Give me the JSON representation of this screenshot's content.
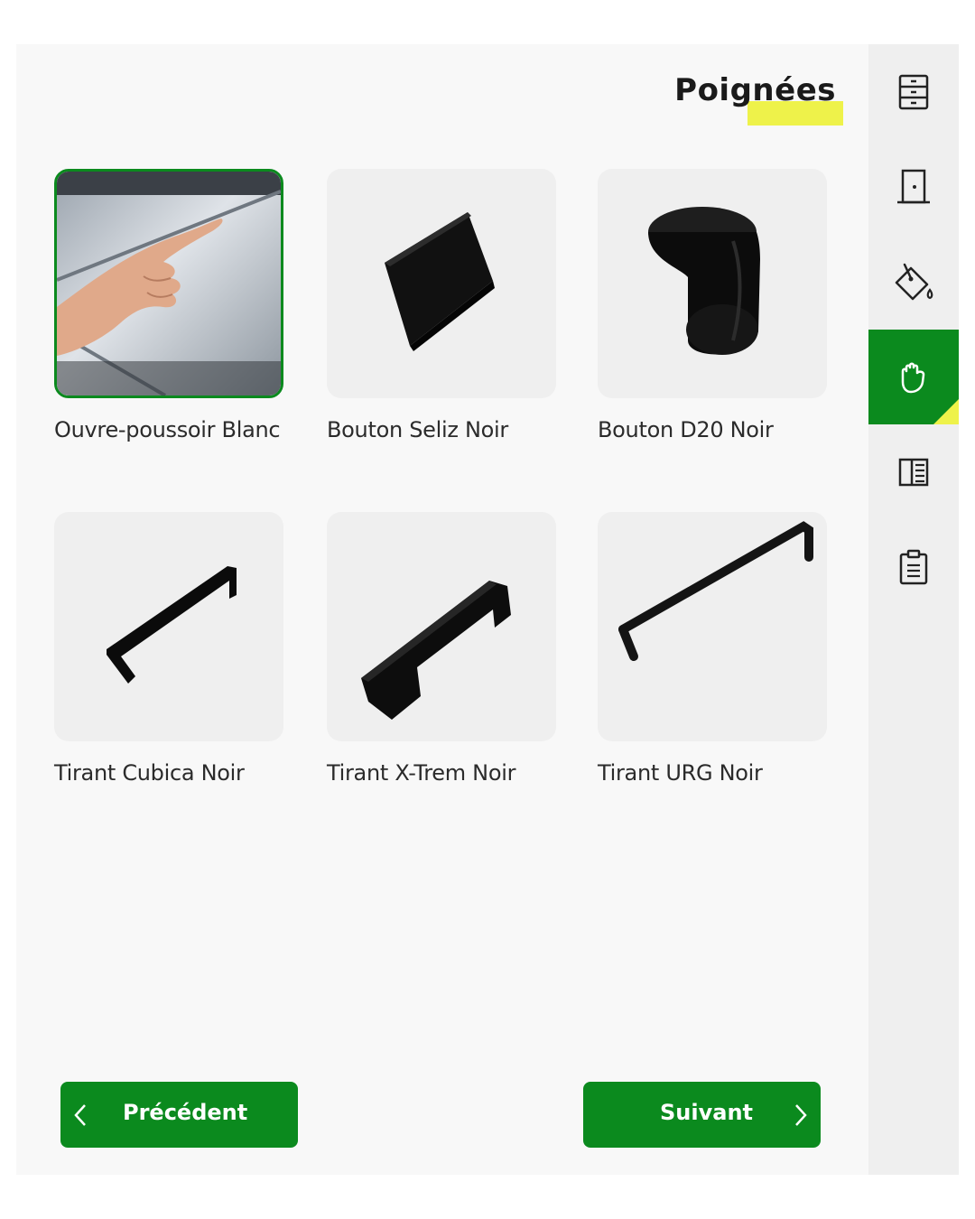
{
  "header": {
    "title": "Poignées"
  },
  "accent_color": "#0b8a1e",
  "highlight_color": "#eef24a",
  "products": [
    {
      "name": "Ouvre-poussoir Blanc",
      "selected": true,
      "image": "finger-pressing-white-panel"
    },
    {
      "name": "Bouton Seliz Noir",
      "selected": false,
      "image": "square-black-knob"
    },
    {
      "name": "Bouton D20 Noir",
      "selected": false,
      "image": "round-black-knob"
    },
    {
      "name": "Tirant Cubica Noir",
      "selected": false,
      "image": "square-bar-handle"
    },
    {
      "name": "Tirant X-Trem Noir",
      "selected": false,
      "image": "thick-bar-handle"
    },
    {
      "name": "Tirant URG Noir",
      "selected": false,
      "image": "long-thin-bar-handle"
    }
  ],
  "sidebar": {
    "items": [
      {
        "icon": "drawers-icon",
        "active": false
      },
      {
        "icon": "door-icon",
        "active": false
      },
      {
        "icon": "paint-bucket-icon",
        "active": false
      },
      {
        "icon": "hand-icon",
        "active": true
      },
      {
        "icon": "panel-icon",
        "active": false
      },
      {
        "icon": "clipboard-icon",
        "active": false
      }
    ]
  },
  "nav": {
    "previous": "Précédent",
    "next": "Suivant"
  }
}
